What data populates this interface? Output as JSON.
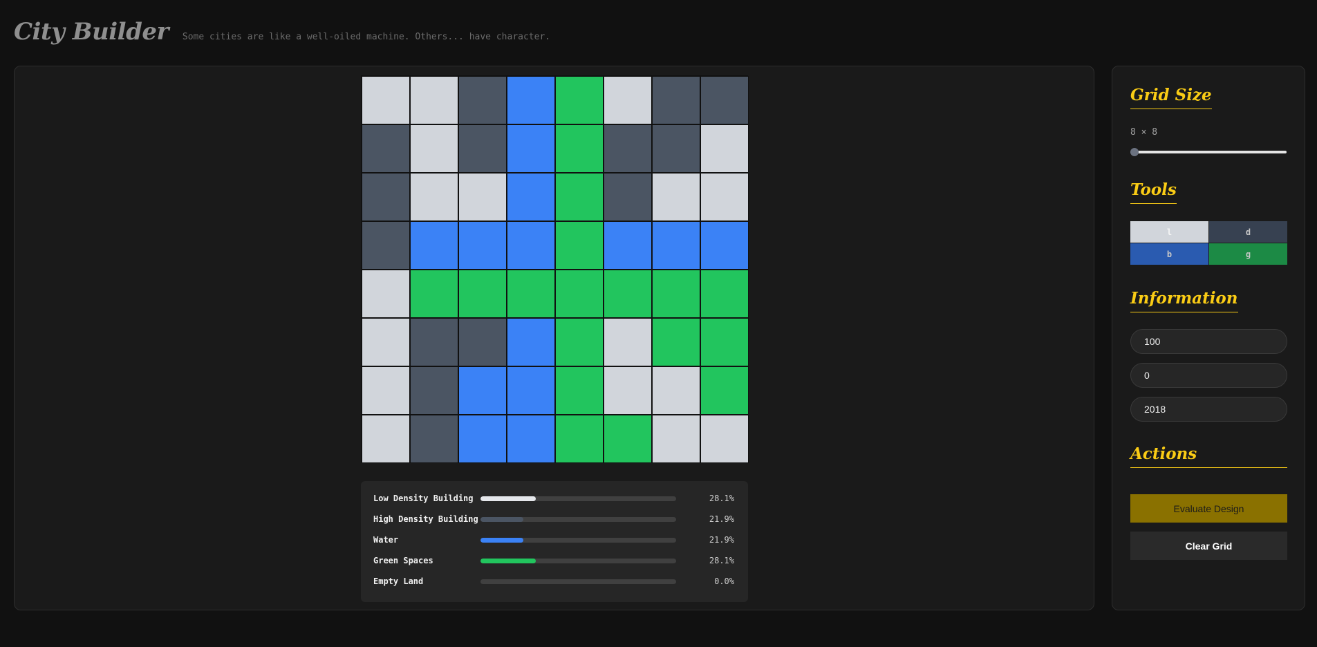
{
  "app": {
    "title": "City Builder",
    "tagline": "Some cities are like a well-oiled machine. Others... have character."
  },
  "grid": {
    "rows": [
      [
        "l",
        "l",
        "d",
        "b",
        "g",
        "l",
        "d",
        "d"
      ],
      [
        "d",
        "l",
        "d",
        "b",
        "g",
        "d",
        "d",
        "l"
      ],
      [
        "d",
        "l",
        "l",
        "b",
        "g",
        "d",
        "l",
        "l"
      ],
      [
        "d",
        "b",
        "b",
        "b",
        "g",
        "b",
        "b",
        "b"
      ],
      [
        "l",
        "g",
        "g",
        "g",
        "g",
        "g",
        "g",
        "g"
      ],
      [
        "l",
        "d",
        "d",
        "b",
        "g",
        "l",
        "g",
        "g"
      ],
      [
        "l",
        "d",
        "b",
        "b",
        "g",
        "l",
        "l",
        "g"
      ],
      [
        "l",
        "d",
        "b",
        "b",
        "g",
        "g",
        "l",
        "l"
      ]
    ]
  },
  "stats": [
    {
      "label": "Low Density Building",
      "percent_text": "28.1%",
      "fraction": 0.281,
      "color": "#e5e7eb"
    },
    {
      "label": "High Density Building",
      "percent_text": "21.9%",
      "fraction": 0.219,
      "color": "#4b5563"
    },
    {
      "label": "Water",
      "percent_text": "21.9%",
      "fraction": 0.219,
      "color": "#3b82f6"
    },
    {
      "label": "Green Spaces",
      "percent_text": "28.1%",
      "fraction": 0.281,
      "color": "#22c55e"
    },
    {
      "label": "Empty Land",
      "percent_text": "0.0%",
      "fraction": 0.0,
      "color": "#737373"
    }
  ],
  "sidebar": {
    "grid_size": {
      "title": "Grid Size",
      "value_label": "8 × 8",
      "slider_fraction": 0.0
    },
    "tools": {
      "title": "Tools",
      "items": [
        "l",
        "d",
        "b",
        "g"
      ]
    },
    "information": {
      "title": "Information",
      "fields": [
        "100",
        "0",
        "2018"
      ]
    },
    "actions": {
      "title": "Actions",
      "evaluate_label": "Evaluate Design",
      "clear_label": "Clear Grid"
    }
  },
  "colors": {
    "low_density": "#d1d5db",
    "high_density": "#4b5563",
    "water": "#3b82f6",
    "green": "#22c55e",
    "accent": "#facc15"
  }
}
